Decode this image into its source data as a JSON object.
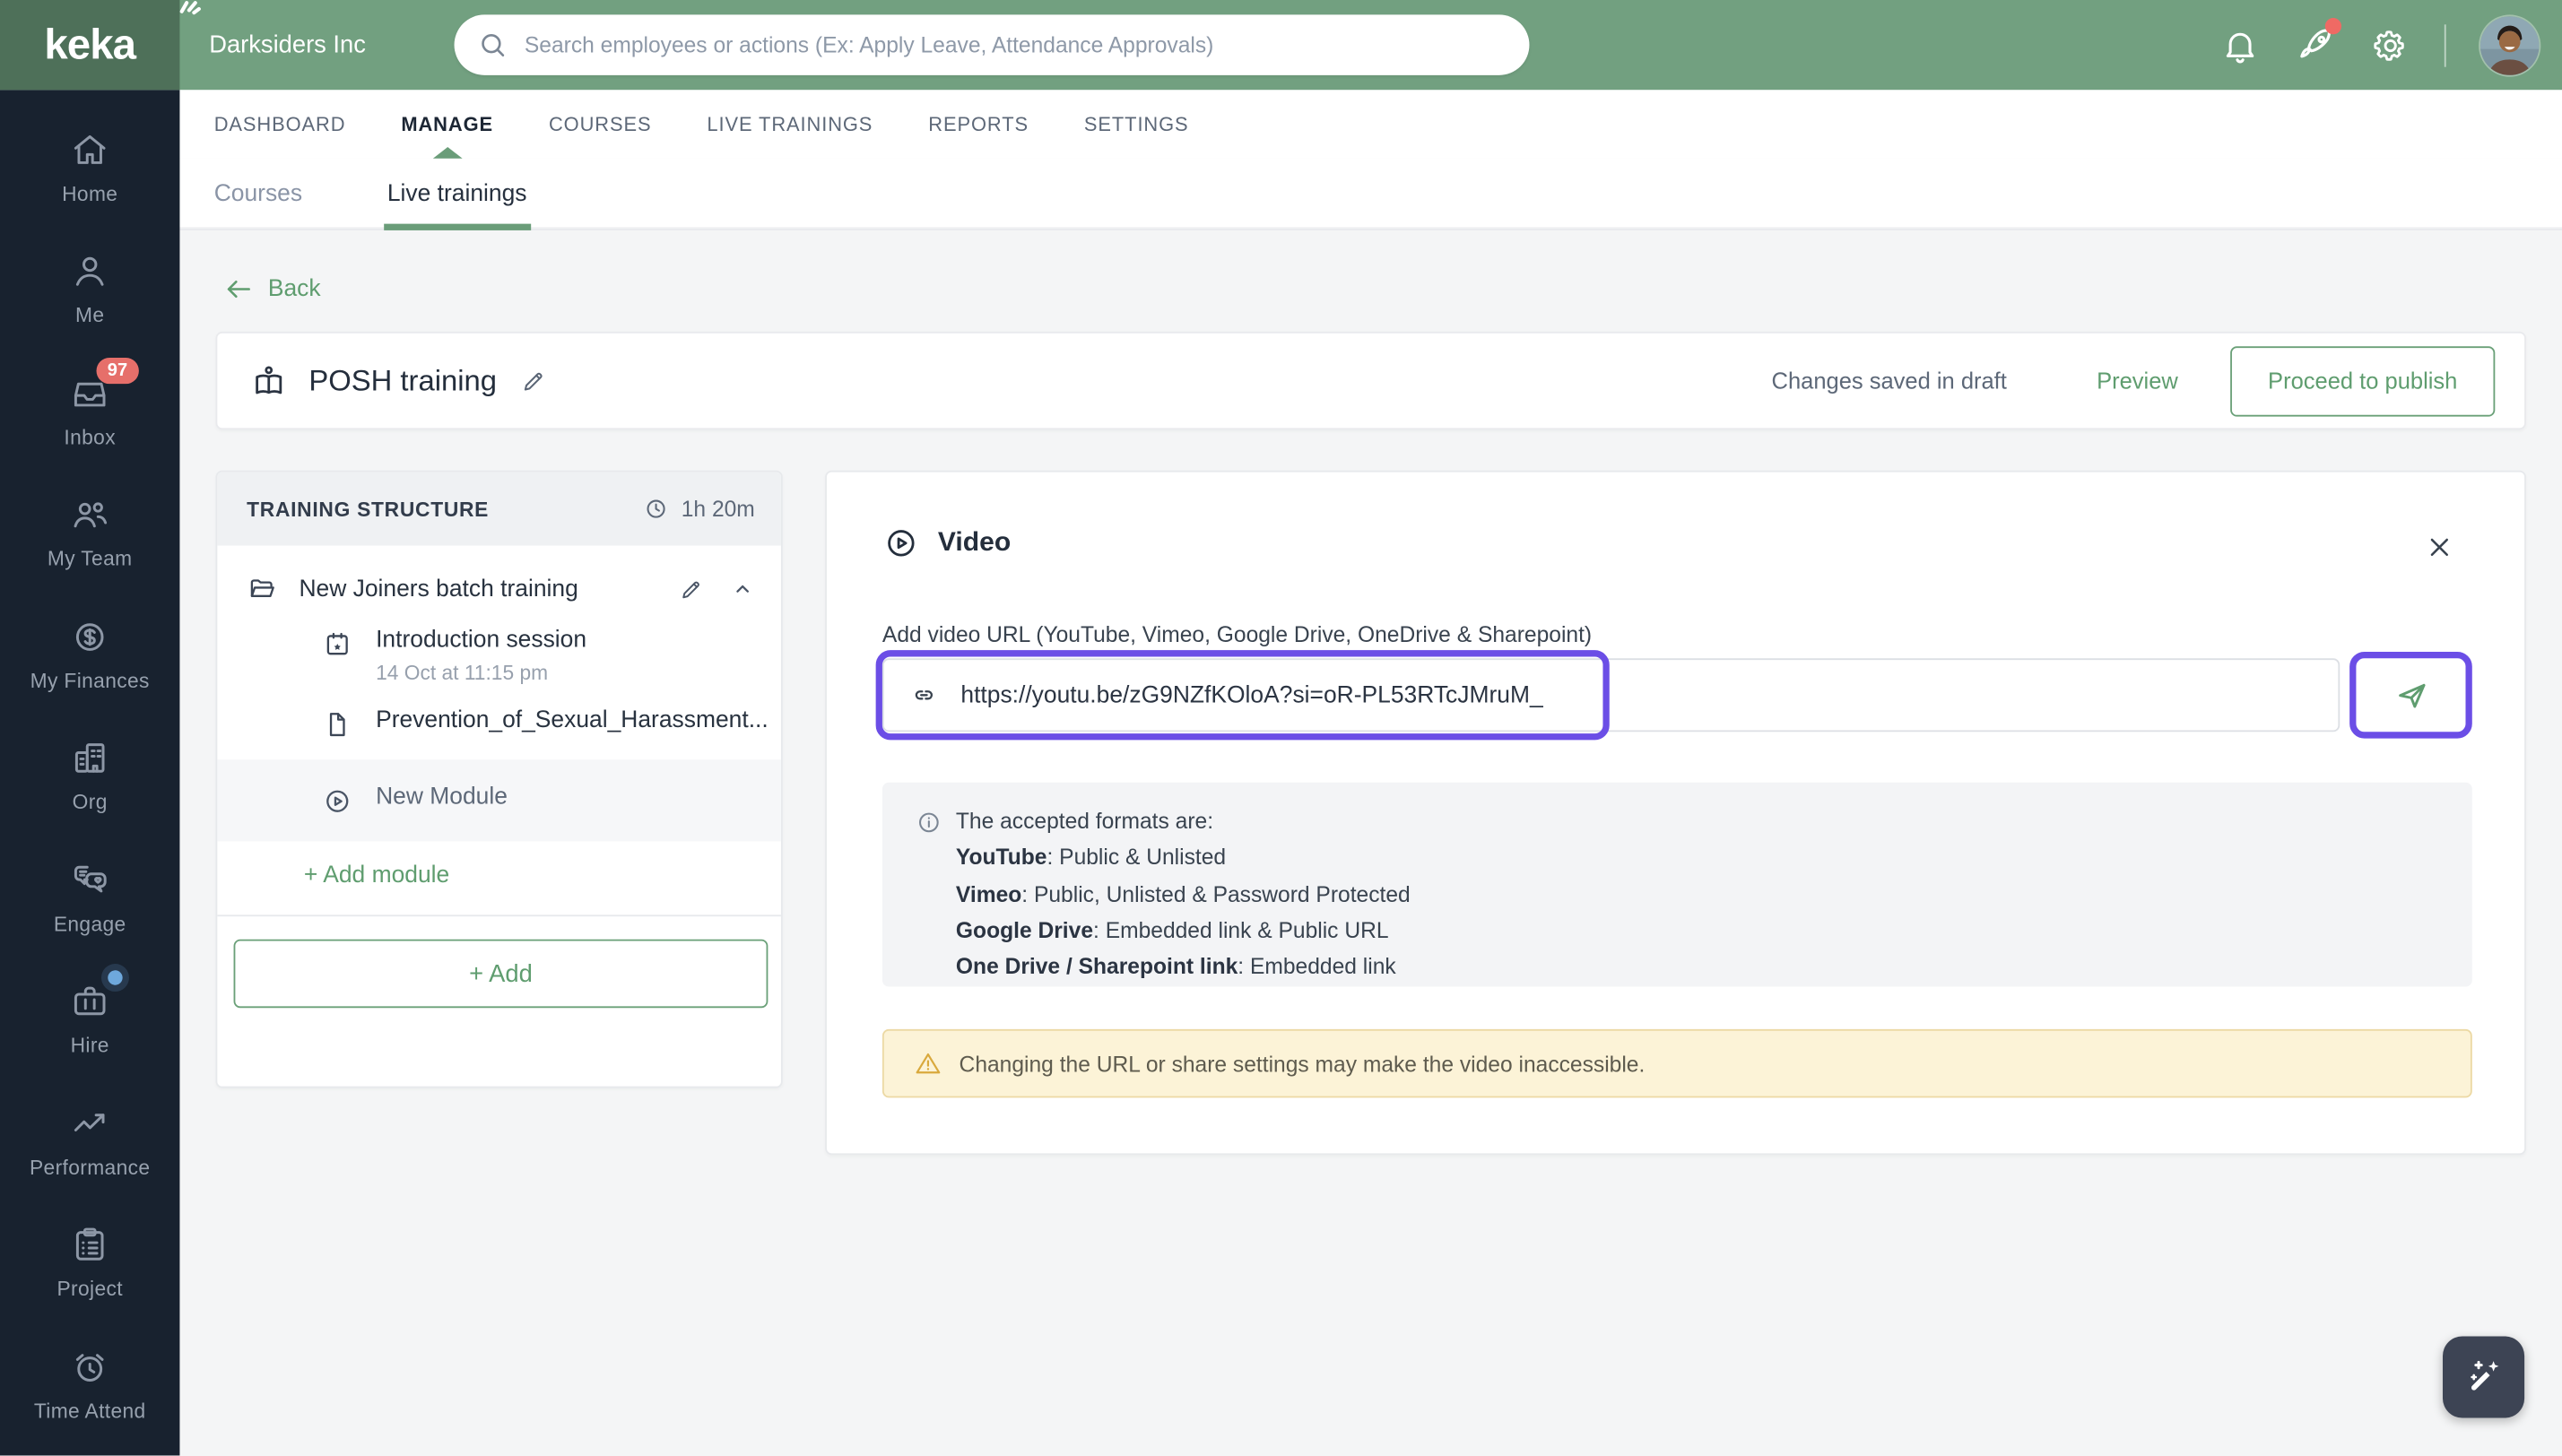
{
  "topbar": {
    "logo_text": "keka",
    "company": "Darksiders Inc",
    "search_placeholder": "Search employees or actions (Ex: Apply Leave, Attendance Approvals)"
  },
  "nav": {
    "tabs": [
      "DASHBOARD",
      "MANAGE",
      "COURSES",
      "LIVE TRAININGS",
      "REPORTS",
      "SETTINGS"
    ],
    "active_tab": "MANAGE",
    "subtabs": [
      "Courses",
      "Live trainings"
    ],
    "active_subtab": "Live trainings"
  },
  "sidebar": {
    "items": [
      {
        "label": "Home"
      },
      {
        "label": "Me"
      },
      {
        "label": "Inbox",
        "badge": "97"
      },
      {
        "label": "My Team"
      },
      {
        "label": "My Finances"
      },
      {
        "label": "Org"
      },
      {
        "label": "Engage"
      },
      {
        "label": "Hire"
      },
      {
        "label": "Performance"
      },
      {
        "label": "Project"
      },
      {
        "label": "Time Attend"
      }
    ]
  },
  "page": {
    "back_label": "Back",
    "title": "POSH training",
    "status_text": "Changes saved in draft",
    "preview_label": "Preview",
    "publish_label": "Proceed to publish"
  },
  "training_structure": {
    "header": "TRAINING STRUCTURE",
    "duration": "1h 20m",
    "module_name": "New Joiners batch training",
    "items": [
      {
        "title": "Introduction session",
        "subtitle": "14 Oct at 11:15 pm"
      },
      {
        "title": "Prevention_of_Sexual_Harassment..."
      },
      {
        "title": "New Module"
      }
    ],
    "add_module_label": "+ Add module",
    "add_label": "+ Add"
  },
  "video_panel": {
    "title": "Video",
    "url_label": "Add video URL (YouTube, Vimeo, Google Drive, OneDrive & Sharepoint)",
    "url_value": "https://youtu.be/zG9NZfKOloA?si=oR-PL53RTcJMruM_",
    "formats_intro": "The accepted formats are:",
    "formats": [
      {
        "label": "YouTube",
        "text": ": Public & Unlisted"
      },
      {
        "label": "Vimeo",
        "text": ": Public, Unlisted & Password Protected"
      },
      {
        "label": "Google Drive",
        "text": ": Embedded link & Public URL"
      },
      {
        "label": "One Drive / Sharepoint link",
        "text": ": Embedded link"
      }
    ],
    "warning_text": "Changing the URL or share settings may make the video inaccessible."
  },
  "colors": {
    "accent_green": "#5f9d6f",
    "topbar_green": "#72a080",
    "logo_block_green": "#4e7059",
    "sidebar_bg": "#18222f",
    "annotation_purple": "#6b4ee6",
    "badge_red": "#e66f6a",
    "warning_bg": "#fcf3d7",
    "warning_border": "#ecd9a4"
  }
}
